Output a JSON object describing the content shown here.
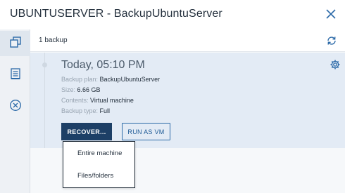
{
  "window": {
    "title": "UBUNTUSERVER - BackupUbuntuServer"
  },
  "left_rail": {
    "items": [
      {
        "icon": "backups-icon",
        "active": true
      },
      {
        "icon": "activities-icon",
        "active": false
      },
      {
        "icon": "cancel-circle-icon",
        "active": false
      }
    ]
  },
  "toolbar": {
    "backup_count": "1 backup"
  },
  "backup": {
    "time": "Today, 05:10 PM",
    "plan_label": "Backup plan: ",
    "plan_value": "BackupUbuntuServer",
    "size_label": "Size: ",
    "size_value": "6.66 GB",
    "contents_label": "Contents: ",
    "contents_value": "Virtual machine",
    "type_label": "Backup type: ",
    "type_value": "Full",
    "recover_label": "RECOVER...",
    "run_vm_label": "RUN AS VM"
  },
  "recover_menu": {
    "items": [
      "Entire machine",
      "Files/folders"
    ]
  },
  "colors": {
    "accent": "#1d3f66",
    "link": "#2c6aa8",
    "card_bg": "#e3ebf5",
    "rail_bg": "#eef1f5"
  }
}
